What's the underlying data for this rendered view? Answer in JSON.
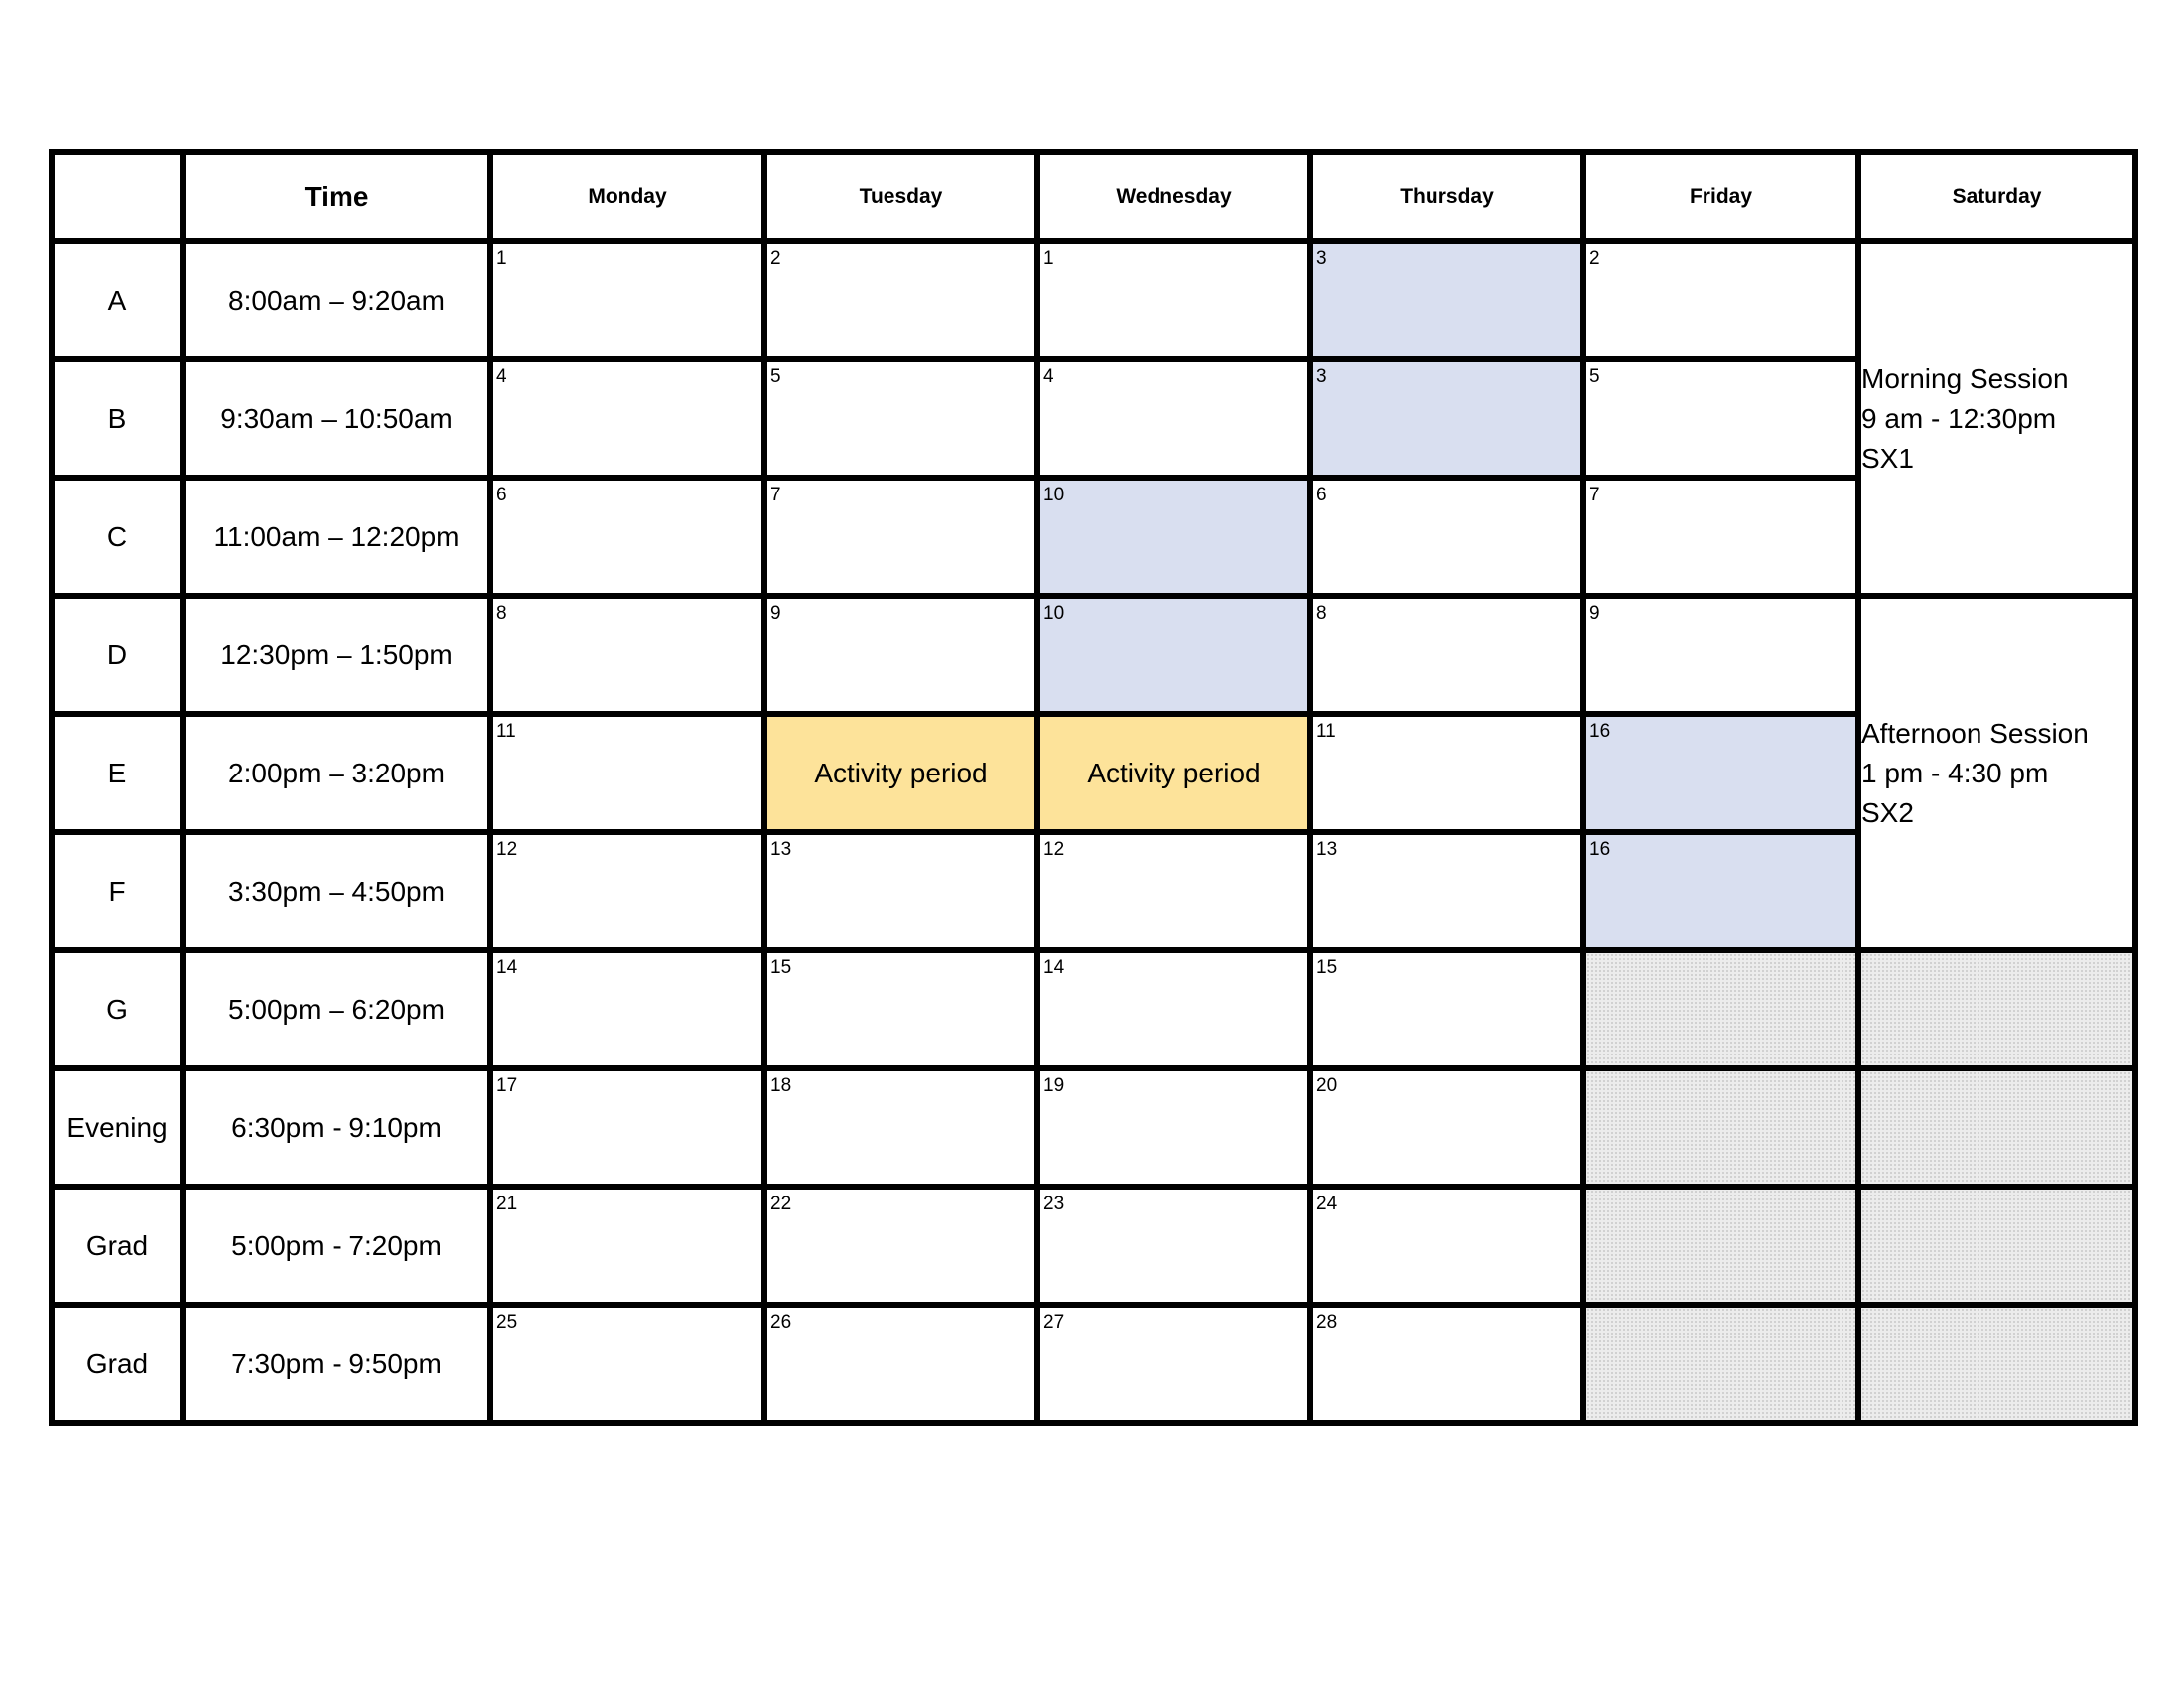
{
  "header": {
    "blank": "",
    "time": "Time",
    "days": [
      "Monday",
      "Tuesday",
      "Wednesday",
      "Thursday",
      "Friday",
      "Saturday"
    ]
  },
  "colors": {
    "highlight_blue": "#d9dff0",
    "activity_yellow": "#fde39a",
    "unavailable_gray": "#ececec"
  },
  "rows": [
    {
      "label": "A",
      "time": "8:00am – 9:20am",
      "cells": [
        {
          "num": "1"
        },
        {
          "num": "2"
        },
        {
          "num": "1"
        },
        {
          "num": "3",
          "fill": "blue"
        },
        {
          "num": "2"
        }
      ]
    },
    {
      "label": "B",
      "time": "9:30am – 10:50am",
      "cells": [
        {
          "num": "4"
        },
        {
          "num": "5"
        },
        {
          "num": "4"
        },
        {
          "num": "3",
          "fill": "blue"
        },
        {
          "num": "5"
        }
      ]
    },
    {
      "label": "C",
      "time": "11:00am – 12:20pm",
      "cells": [
        {
          "num": "6"
        },
        {
          "num": "7"
        },
        {
          "num": "10",
          "fill": "blue"
        },
        {
          "num": "6"
        },
        {
          "num": "7"
        }
      ]
    },
    {
      "label": "D",
      "time": "12:30pm – 1:50pm",
      "cells": [
        {
          "num": "8"
        },
        {
          "num": "9"
        },
        {
          "num": "10",
          "fill": "blue"
        },
        {
          "num": "8"
        },
        {
          "num": "9"
        }
      ]
    },
    {
      "label": "E",
      "time": "2:00pm – 3:20pm",
      "cells": [
        {
          "num": "11"
        },
        {
          "text": "Activity period",
          "fill": "yellow"
        },
        {
          "text": "Activity period",
          "fill": "yellow"
        },
        {
          "num": "11"
        },
        {
          "num": "16",
          "fill": "blue"
        }
      ]
    },
    {
      "label": "F",
      "time": "3:30pm – 4:50pm",
      "cells": [
        {
          "num": "12"
        },
        {
          "num": "13"
        },
        {
          "num": "12"
        },
        {
          "num": "13"
        },
        {
          "num": "16",
          "fill": "blue"
        }
      ]
    },
    {
      "label": "G",
      "time": "5:00pm – 6:20pm",
      "cells": [
        {
          "num": "14"
        },
        {
          "num": "15"
        },
        {
          "num": "14"
        },
        {
          "num": "15"
        },
        {
          "fill": "gray"
        }
      ]
    },
    {
      "label": "Evening",
      "time": "6:30pm - 9:10pm",
      "cells": [
        {
          "num": "17"
        },
        {
          "num": "18"
        },
        {
          "num": "19"
        },
        {
          "num": "20"
        },
        {
          "fill": "gray"
        }
      ]
    },
    {
      "label": "Grad",
      "time": "5:00pm - 7:20pm",
      "cells": [
        {
          "num": "21"
        },
        {
          "num": "22"
        },
        {
          "num": "23"
        },
        {
          "num": "24"
        },
        {
          "fill": "gray"
        }
      ]
    },
    {
      "label": "Grad",
      "time": "7:30pm - 9:50pm",
      "cells": [
        {
          "num": "25"
        },
        {
          "num": "26"
        },
        {
          "num": "27"
        },
        {
          "num": "28"
        },
        {
          "fill": "gray"
        }
      ]
    }
  ],
  "saturday": {
    "morning": {
      "title": "Morning Session",
      "time": "9 am - 12:30pm",
      "code": "SX1"
    },
    "afternoon": {
      "title": "Afternoon Session",
      "time": "1 pm - 4:30 pm",
      "code": "SX2"
    }
  }
}
